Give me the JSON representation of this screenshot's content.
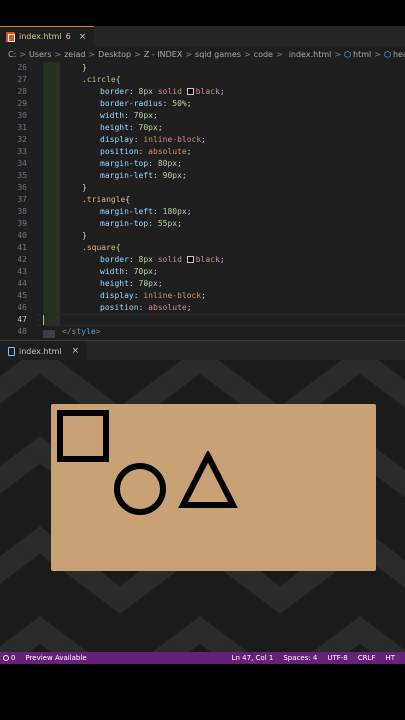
{
  "tab": {
    "label": "index.html",
    "count": "6",
    "close": "×",
    "icon": "html-file-icon"
  },
  "breadcrumb": {
    "items": [
      "C:",
      "Users",
      "zeiad",
      "Desktop",
      "Z - INDEX",
      "sqid games",
      "code",
      "index.html",
      "html",
      "head"
    ],
    "separator": ">"
  },
  "editor": {
    "line_numbers": [
      "26",
      "27",
      "28",
      "29",
      "30",
      "31",
      "32",
      "33",
      "34",
      "35",
      "36",
      "37",
      "38",
      "39",
      "40",
      "41",
      "42",
      "43",
      "44",
      "45",
      "46",
      "47",
      "48"
    ],
    "active_line": "47",
    "lines": [
      {
        "i": 1,
        "tokens": [
          [
            "pun",
            "}"
          ]
        ]
      },
      {
        "i": 1,
        "tokens": [
          [
            "sel",
            ".circle"
          ],
          [
            "pun",
            "{"
          ]
        ]
      },
      {
        "i": 2,
        "tokens": [
          [
            "prop",
            "border"
          ],
          [
            "pun",
            ": "
          ],
          [
            "num",
            "8px"
          ],
          [
            "val",
            " solid "
          ],
          [
            "swatch",
            ""
          ],
          [
            "val",
            "black"
          ],
          [
            "pun",
            ";"
          ]
        ]
      },
      {
        "i": 2,
        "tokens": [
          [
            "prop",
            "border-radius"
          ],
          [
            "pun",
            ": "
          ],
          [
            "num",
            "50%"
          ],
          [
            "pun",
            ";"
          ]
        ]
      },
      {
        "i": 2,
        "tokens": [
          [
            "prop",
            "width"
          ],
          [
            "pun",
            ": "
          ],
          [
            "num",
            "70px"
          ],
          [
            "pun",
            ";"
          ]
        ]
      },
      {
        "i": 2,
        "tokens": [
          [
            "prop",
            "height"
          ],
          [
            "pun",
            ": "
          ],
          [
            "num",
            "70px"
          ],
          [
            "pun",
            ";"
          ]
        ]
      },
      {
        "i": 2,
        "tokens": [
          [
            "prop",
            "display"
          ],
          [
            "pun",
            ": "
          ],
          [
            "val",
            "inline-block"
          ],
          [
            "pun",
            ";"
          ]
        ]
      },
      {
        "i": 2,
        "tokens": [
          [
            "prop",
            "position"
          ],
          [
            "pun",
            ": "
          ],
          [
            "val",
            "absolute"
          ],
          [
            "pun",
            ";"
          ]
        ]
      },
      {
        "i": 2,
        "tokens": [
          [
            "prop",
            "margin-top"
          ],
          [
            "pun",
            ": "
          ],
          [
            "num",
            "80px"
          ],
          [
            "pun",
            ";"
          ]
        ]
      },
      {
        "i": 2,
        "tokens": [
          [
            "prop",
            "margin-left"
          ],
          [
            "pun",
            ": "
          ],
          [
            "num",
            "90px"
          ],
          [
            "pun",
            ";"
          ]
        ]
      },
      {
        "i": 1,
        "tokens": [
          [
            "pun",
            "}"
          ]
        ]
      },
      {
        "i": 1,
        "tokens": [
          [
            "sel",
            ".triangle"
          ],
          [
            "pun",
            "{"
          ]
        ]
      },
      {
        "i": 2,
        "tokens": [
          [
            "prop",
            "margin-left"
          ],
          [
            "pun",
            ": "
          ],
          [
            "num",
            "180px"
          ],
          [
            "pun",
            ";"
          ]
        ]
      },
      {
        "i": 2,
        "tokens": [
          [
            "prop",
            "margin-top"
          ],
          [
            "pun",
            ": "
          ],
          [
            "num",
            "55px"
          ],
          [
            "pun",
            ";"
          ]
        ]
      },
      {
        "i": 1,
        "tokens": [
          [
            "pun",
            "}"
          ]
        ]
      },
      {
        "i": 1,
        "tokens": [
          [
            "sel",
            ".square"
          ],
          [
            "pun",
            "{"
          ]
        ]
      },
      {
        "i": 2,
        "tokens": [
          [
            "prop",
            "border"
          ],
          [
            "pun",
            ": "
          ],
          [
            "num",
            "8px"
          ],
          [
            "val",
            " solid "
          ],
          [
            "swatch",
            ""
          ],
          [
            "val",
            "black"
          ],
          [
            "pun",
            ";"
          ]
        ]
      },
      {
        "i": 2,
        "tokens": [
          [
            "prop",
            "width"
          ],
          [
            "pun",
            ": "
          ],
          [
            "num",
            "70px"
          ],
          [
            "pun",
            ";"
          ]
        ]
      },
      {
        "i": 2,
        "tokens": [
          [
            "prop",
            "height"
          ],
          [
            "pun",
            ": "
          ],
          [
            "num",
            "70px"
          ],
          [
            "pun",
            ";"
          ]
        ]
      },
      {
        "i": 2,
        "tokens": [
          [
            "prop",
            "display"
          ],
          [
            "pun",
            ": "
          ],
          [
            "val",
            "inline-block"
          ],
          [
            "pun",
            ";"
          ]
        ]
      },
      {
        "i": 2,
        "tokens": [
          [
            "prop",
            "position"
          ],
          [
            "pun",
            ": "
          ],
          [
            "val",
            "absolute"
          ],
          [
            "pun",
            ";"
          ]
        ]
      },
      {
        "i": 0,
        "tokens": []
      },
      {
        "i": 0,
        "tokens": [
          [
            "tagc",
            "</"
          ],
          [
            "tagn",
            "style"
          ],
          [
            "tagc",
            ">"
          ]
        ]
      }
    ]
  },
  "preview_tab": {
    "label": "index.html",
    "close": "×",
    "icon": "document-icon"
  },
  "preview": {
    "card_color": "#c8a275",
    "shapes": [
      "square",
      "circle",
      "triangle"
    ]
  },
  "statusbar": {
    "left": {
      "problems": "0",
      "preview": "Preview Available"
    },
    "right": [
      "Ln 47, Col 1",
      "Spaces: 4",
      "UTF-8",
      "CRLF",
      "HT"
    ],
    "color": "#68217a"
  }
}
